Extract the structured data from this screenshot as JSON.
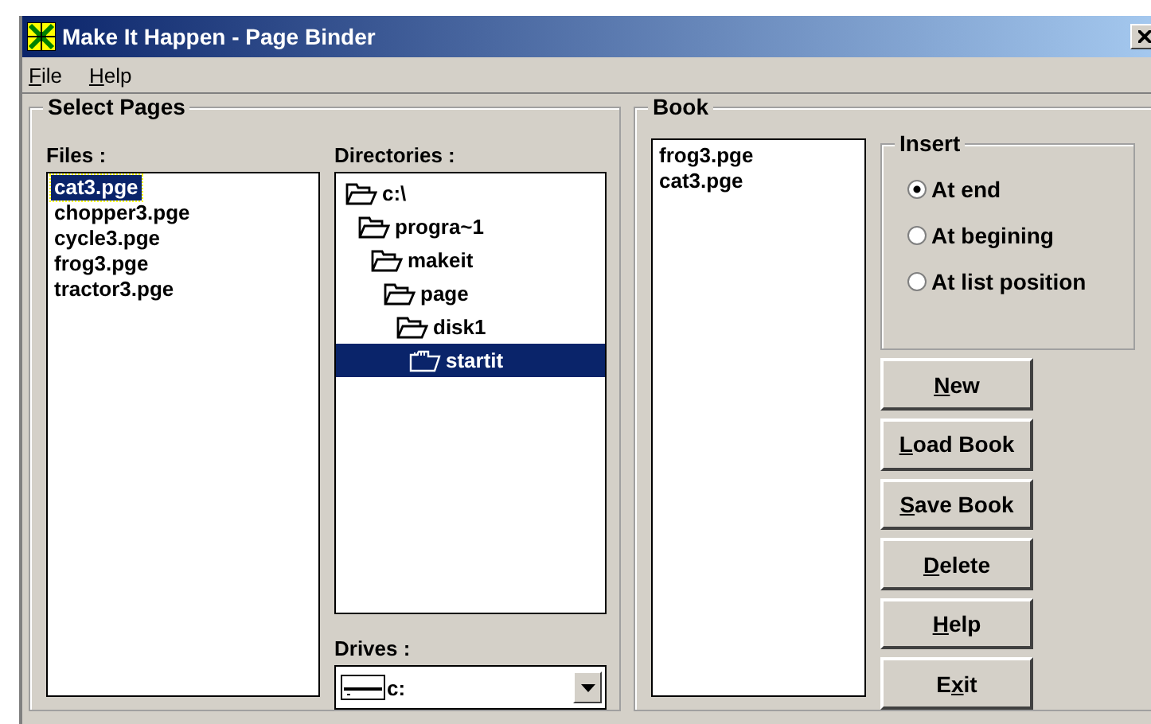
{
  "window": {
    "title": "Make It Happen - Page Binder"
  },
  "menu": [
    {
      "key": "F",
      "post": "ile"
    },
    {
      "key": "H",
      "post": "elp"
    }
  ],
  "select_pages": {
    "title": "Select Pages",
    "files_label": "Files :",
    "files": [
      {
        "name": "cat3.pge",
        "selected": true
      },
      {
        "name": "chopper3.pge",
        "selected": false
      },
      {
        "name": "cycle3.pge",
        "selected": false
      },
      {
        "name": "frog3.pge",
        "selected": false
      },
      {
        "name": "tractor3.pge",
        "selected": false
      }
    ],
    "directories_label": "Directories :",
    "directories": [
      {
        "name": "c:\\",
        "selected": false,
        "children": [
          {
            "name": "progra~1",
            "selected": false,
            "children": [
              {
                "name": "makeit",
                "selected": false,
                "children": [
                  {
                    "name": "page",
                    "selected": false,
                    "children": [
                      {
                        "name": "disk1",
                        "selected": false,
                        "children": [
                          {
                            "name": "startit",
                            "selected": true
                          }
                        ]
                      }
                    ]
                  }
                ]
              }
            ]
          }
        ]
      }
    ],
    "drives_label": "Drives :",
    "drive": "c:"
  },
  "book": {
    "title": "Book",
    "pages": [
      "frog3.pge",
      "cat3.pge"
    ],
    "insert": {
      "title": "Insert",
      "options": [
        {
          "label": "At end",
          "selected": true
        },
        {
          "label": "At begining",
          "selected": false
        },
        {
          "label": "At list position",
          "selected": false
        }
      ]
    },
    "buttons": [
      {
        "key": "N",
        "post": "ew"
      },
      {
        "key": "L",
        "post": "oad Book"
      },
      {
        "key": "S",
        "post": "ave Book"
      },
      {
        "key": "D",
        "post": "elete"
      },
      {
        "key": "H",
        "post": "elp"
      },
      {
        "pre": "E",
        "key": "x",
        "post": "it"
      }
    ]
  }
}
